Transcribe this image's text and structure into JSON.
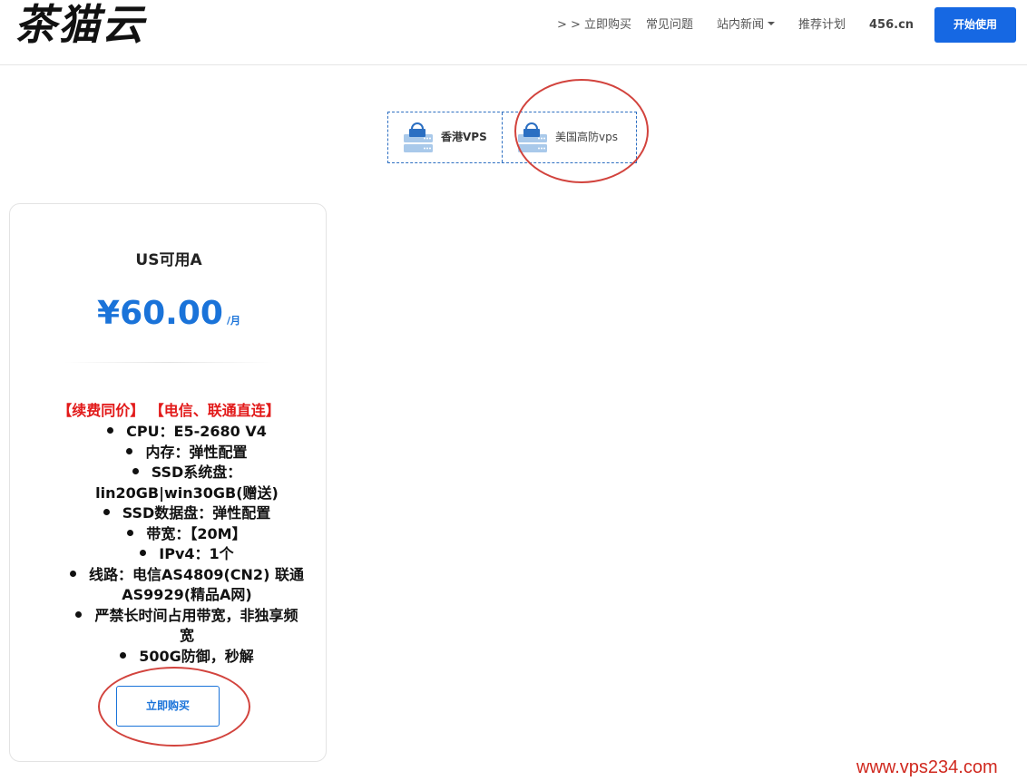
{
  "header": {
    "logo": "茶猫云",
    "nav": [
      "> > 立即购买",
      "常见问题",
      "站内新闻",
      "推荐计划",
      "456.cn"
    ],
    "start_button": "开始使用"
  },
  "tabs": [
    {
      "label": "香港VPS",
      "icon": "server-icon"
    },
    {
      "label": "美国高防vps",
      "icon": "server-icon"
    }
  ],
  "product": {
    "name": "US可用A",
    "price": "¥60.00",
    "unit": "/月",
    "promo": "【续费同价】 【电信、联通直连】",
    "features": [
      "CPU：E5-2680 V4",
      "内存：弹性配置",
      "SSD系统盘：",
      "lin20GB|win30GB(赠送)",
      "SSD数据盘：弹性配置",
      "带宽：【20M】",
      "IPv4：1个",
      "线路：电信AS4809(CN2) 联通",
      "AS9929(精品A网)",
      "严禁长时间占用带宽，非独享频",
      "宽",
      "500G防御，秒解"
    ],
    "buy_button": "立即购买"
  },
  "watermark": "www.vps234.com",
  "colors": {
    "accent": "#1668e3",
    "price": "#1a73d9",
    "promo": "#e21a1a",
    "annotation": "#d2433d"
  }
}
